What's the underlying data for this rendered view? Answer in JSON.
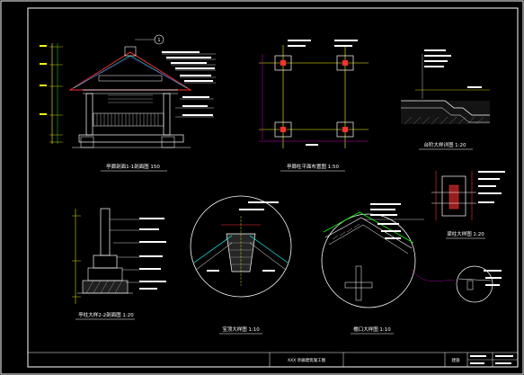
{
  "sheet": {
    "background": "#000000",
    "frame_color": "#ffffff",
    "line_colors": {
      "yellow": "#ffff00",
      "green": "#00ff00",
      "cyan": "#00ffff",
      "red": "#ff3030",
      "magenta": "#ff00ff",
      "white": "#ffffff"
    }
  },
  "drawings": {
    "elevation_section": {
      "caption": "亭廊剖面1-1剖面图 150",
      "marker": "1"
    },
    "column_plan": {
      "caption": "亭廊柱平面布置图 1:50"
    },
    "step_detail": {
      "caption": "台阶大样详图 1:20"
    },
    "column_footing": {
      "caption": "亭柱大样2-2剖面图 1:20"
    },
    "ridge_detail": {
      "caption": "宝顶大样图 1:10"
    },
    "eave_detail": {
      "caption": "檐口大样图 1:10"
    },
    "joint_detail": {
      "caption": "梁柱大样图 1:20"
    }
  },
  "title_block": {
    "project": "XXX 亭廊建筑施工图",
    "sheet_label": "建施"
  }
}
